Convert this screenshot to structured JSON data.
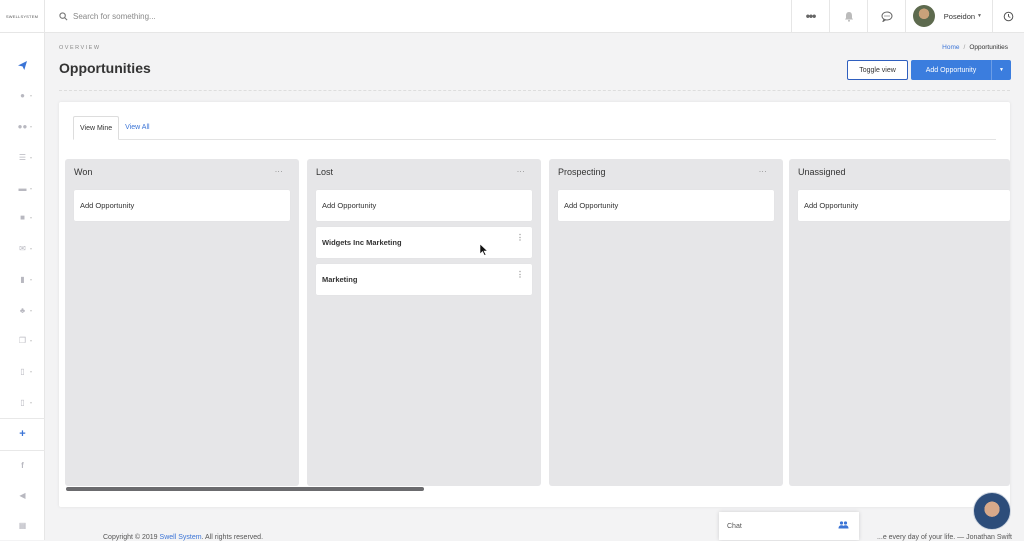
{
  "header": {
    "logo_text": "SWELLSYSTEM",
    "search_placeholder": "Search for something...",
    "more_icon": "ellipsis-icon",
    "user_name": "Poseidon"
  },
  "sidebar": {
    "items": [
      "send-icon",
      "user-icon",
      "users-icon",
      "list-icon",
      "folder-icon",
      "check-icon",
      "mail-icon",
      "trash-icon",
      "hierarchy-icon",
      "copy-icon",
      "document-icon",
      "file-icon",
      "plus-icon",
      "facebook-icon",
      "megaphone-icon",
      "building-icon"
    ]
  },
  "page": {
    "overview": "OVERVIEW",
    "title": "Opportunities",
    "breadcrumb_home": "Home",
    "breadcrumb_sep": "/",
    "breadcrumb_current": "Opportunities",
    "toggle_view": "Toggle view",
    "add_opportunity": "Add Opportunity"
  },
  "tabs": [
    {
      "label": "View Mine",
      "active": true
    },
    {
      "label": "View All",
      "active": false
    }
  ],
  "columns": [
    {
      "title": "Won",
      "menu": "...",
      "cards": [
        {
          "label": "Add Opportunity",
          "bold": false
        }
      ]
    },
    {
      "title": "Lost",
      "menu": "...",
      "cards": [
        {
          "label": "Add Opportunity",
          "bold": false
        },
        {
          "label": "Widgets Inc Marketing",
          "bold": true
        },
        {
          "label": "Marketing",
          "bold": true
        }
      ]
    },
    {
      "title": "Prospecting",
      "menu": "...",
      "cards": [
        {
          "label": "Add Opportunity",
          "bold": false
        }
      ]
    },
    {
      "title": "Unassigned",
      "menu": "",
      "cards": [
        {
          "label": "Add Opportunity",
          "bold": false
        }
      ]
    }
  ],
  "footer": {
    "copyright_prefix": "Copyright © 2019",
    "company": "Swell System",
    "rights": ". All rights reserved.",
    "tagline": "...e every day of your life. — Jonathan Swift"
  },
  "chat": {
    "label": "Chat"
  },
  "colors": {
    "accent": "#3b7dde",
    "link": "#3b74d6"
  }
}
